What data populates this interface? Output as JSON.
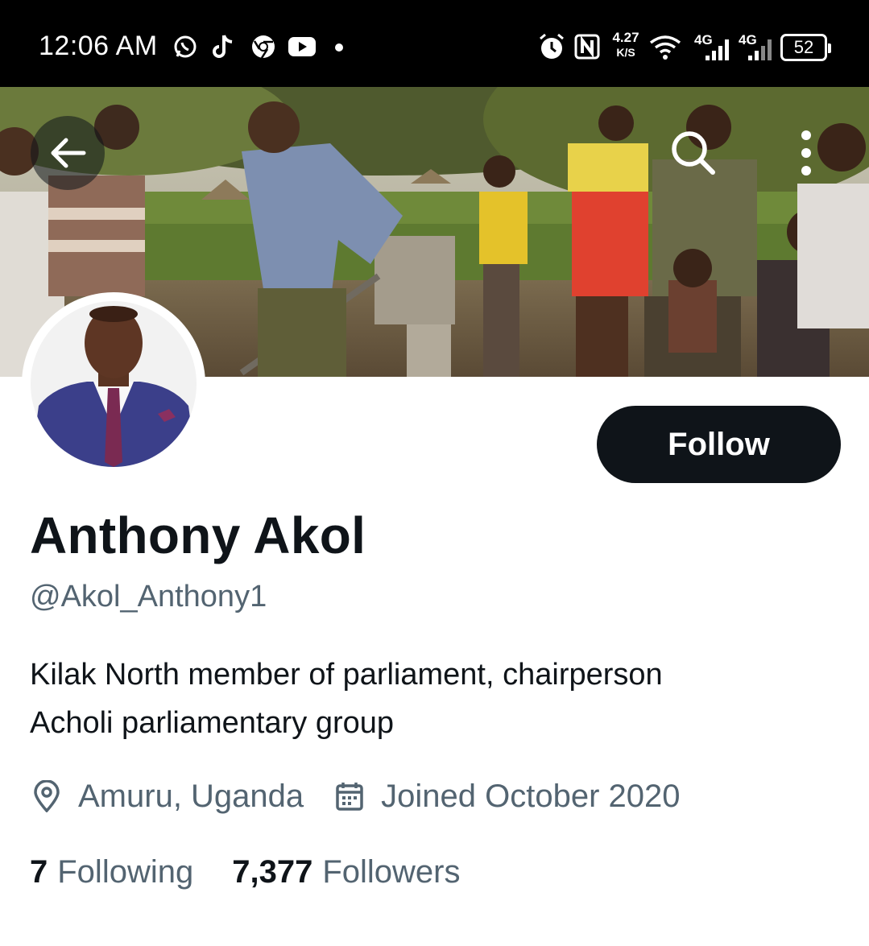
{
  "status_bar": {
    "time": "12:06 AM",
    "notification_icons": [
      "whatsapp-icon",
      "tiktok-icon",
      "chrome-icon",
      "youtube-icon",
      "more-dot-icon"
    ],
    "system_icons": [
      "alarm-icon",
      "nfc-icon",
      "wifi-icon",
      "signal-icon",
      "signal-icon"
    ],
    "net_speed": "4.27",
    "net_speed_unit": "K/S",
    "network_1": "4G",
    "network_2": "4G",
    "battery": "52"
  },
  "header": {
    "back_icon": "arrow-left-icon",
    "search_icon": "search-icon",
    "more_icon": "more-vertical-icon"
  },
  "profile": {
    "name": "Anthony Akol",
    "handle": "@Akol_Anthony1",
    "bio_line1": "Kilak North member of parliament, chairperson",
    "bio_line2": "Acholi parliamentary group",
    "location": "Amuru, Uganda",
    "joined": "Joined October 2020",
    "following_count": "7",
    "following_label": "Following",
    "followers_count": "7,377",
    "followers_label": "Followers",
    "follow_label": "Follow"
  },
  "colors": {
    "text_primary": "#0f1419",
    "text_secondary": "#536471",
    "button_bg": "#0f1419"
  }
}
